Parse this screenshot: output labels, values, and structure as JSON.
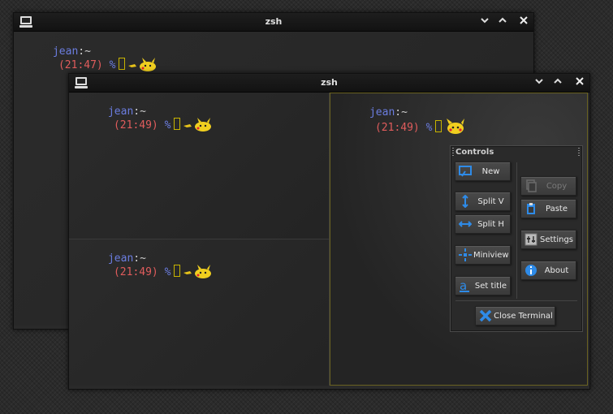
{
  "back_window": {
    "title": "zsh",
    "prompt": {
      "user": "jean",
      "sep": ":~",
      "time": "(21:47)",
      "pct": "%"
    }
  },
  "front_window": {
    "title": "zsh",
    "panes": [
      {
        "user": "jean",
        "sep": ":~",
        "time": "(21:49)",
        "pct": "%"
      },
      {
        "user": "jean",
        "sep": ":~",
        "time": "(21:49)",
        "pct": "%"
      },
      {
        "user": "jean",
        "sep": ":~",
        "time": "(21:49)",
        "pct": "%"
      }
    ]
  },
  "controls": {
    "title": "Controls",
    "new": "New",
    "split_v": "Split V",
    "split_h": "Split H",
    "miniview": "Miniview",
    "set_title": "Set title",
    "copy": "Copy",
    "paste": "Paste",
    "settings": "Settings",
    "about": "About",
    "close_terminal": "Close Terminal"
  },
  "icons": {
    "terminal": "terminal-icon",
    "minimize": "chevron-down-icon",
    "maximize": "chevron-up-icon",
    "close": "close-icon"
  },
  "colors": {
    "user": "#6b7de0",
    "time": "#e05c5c",
    "accent": "#2e8be8",
    "cursor": "#c8b400"
  }
}
